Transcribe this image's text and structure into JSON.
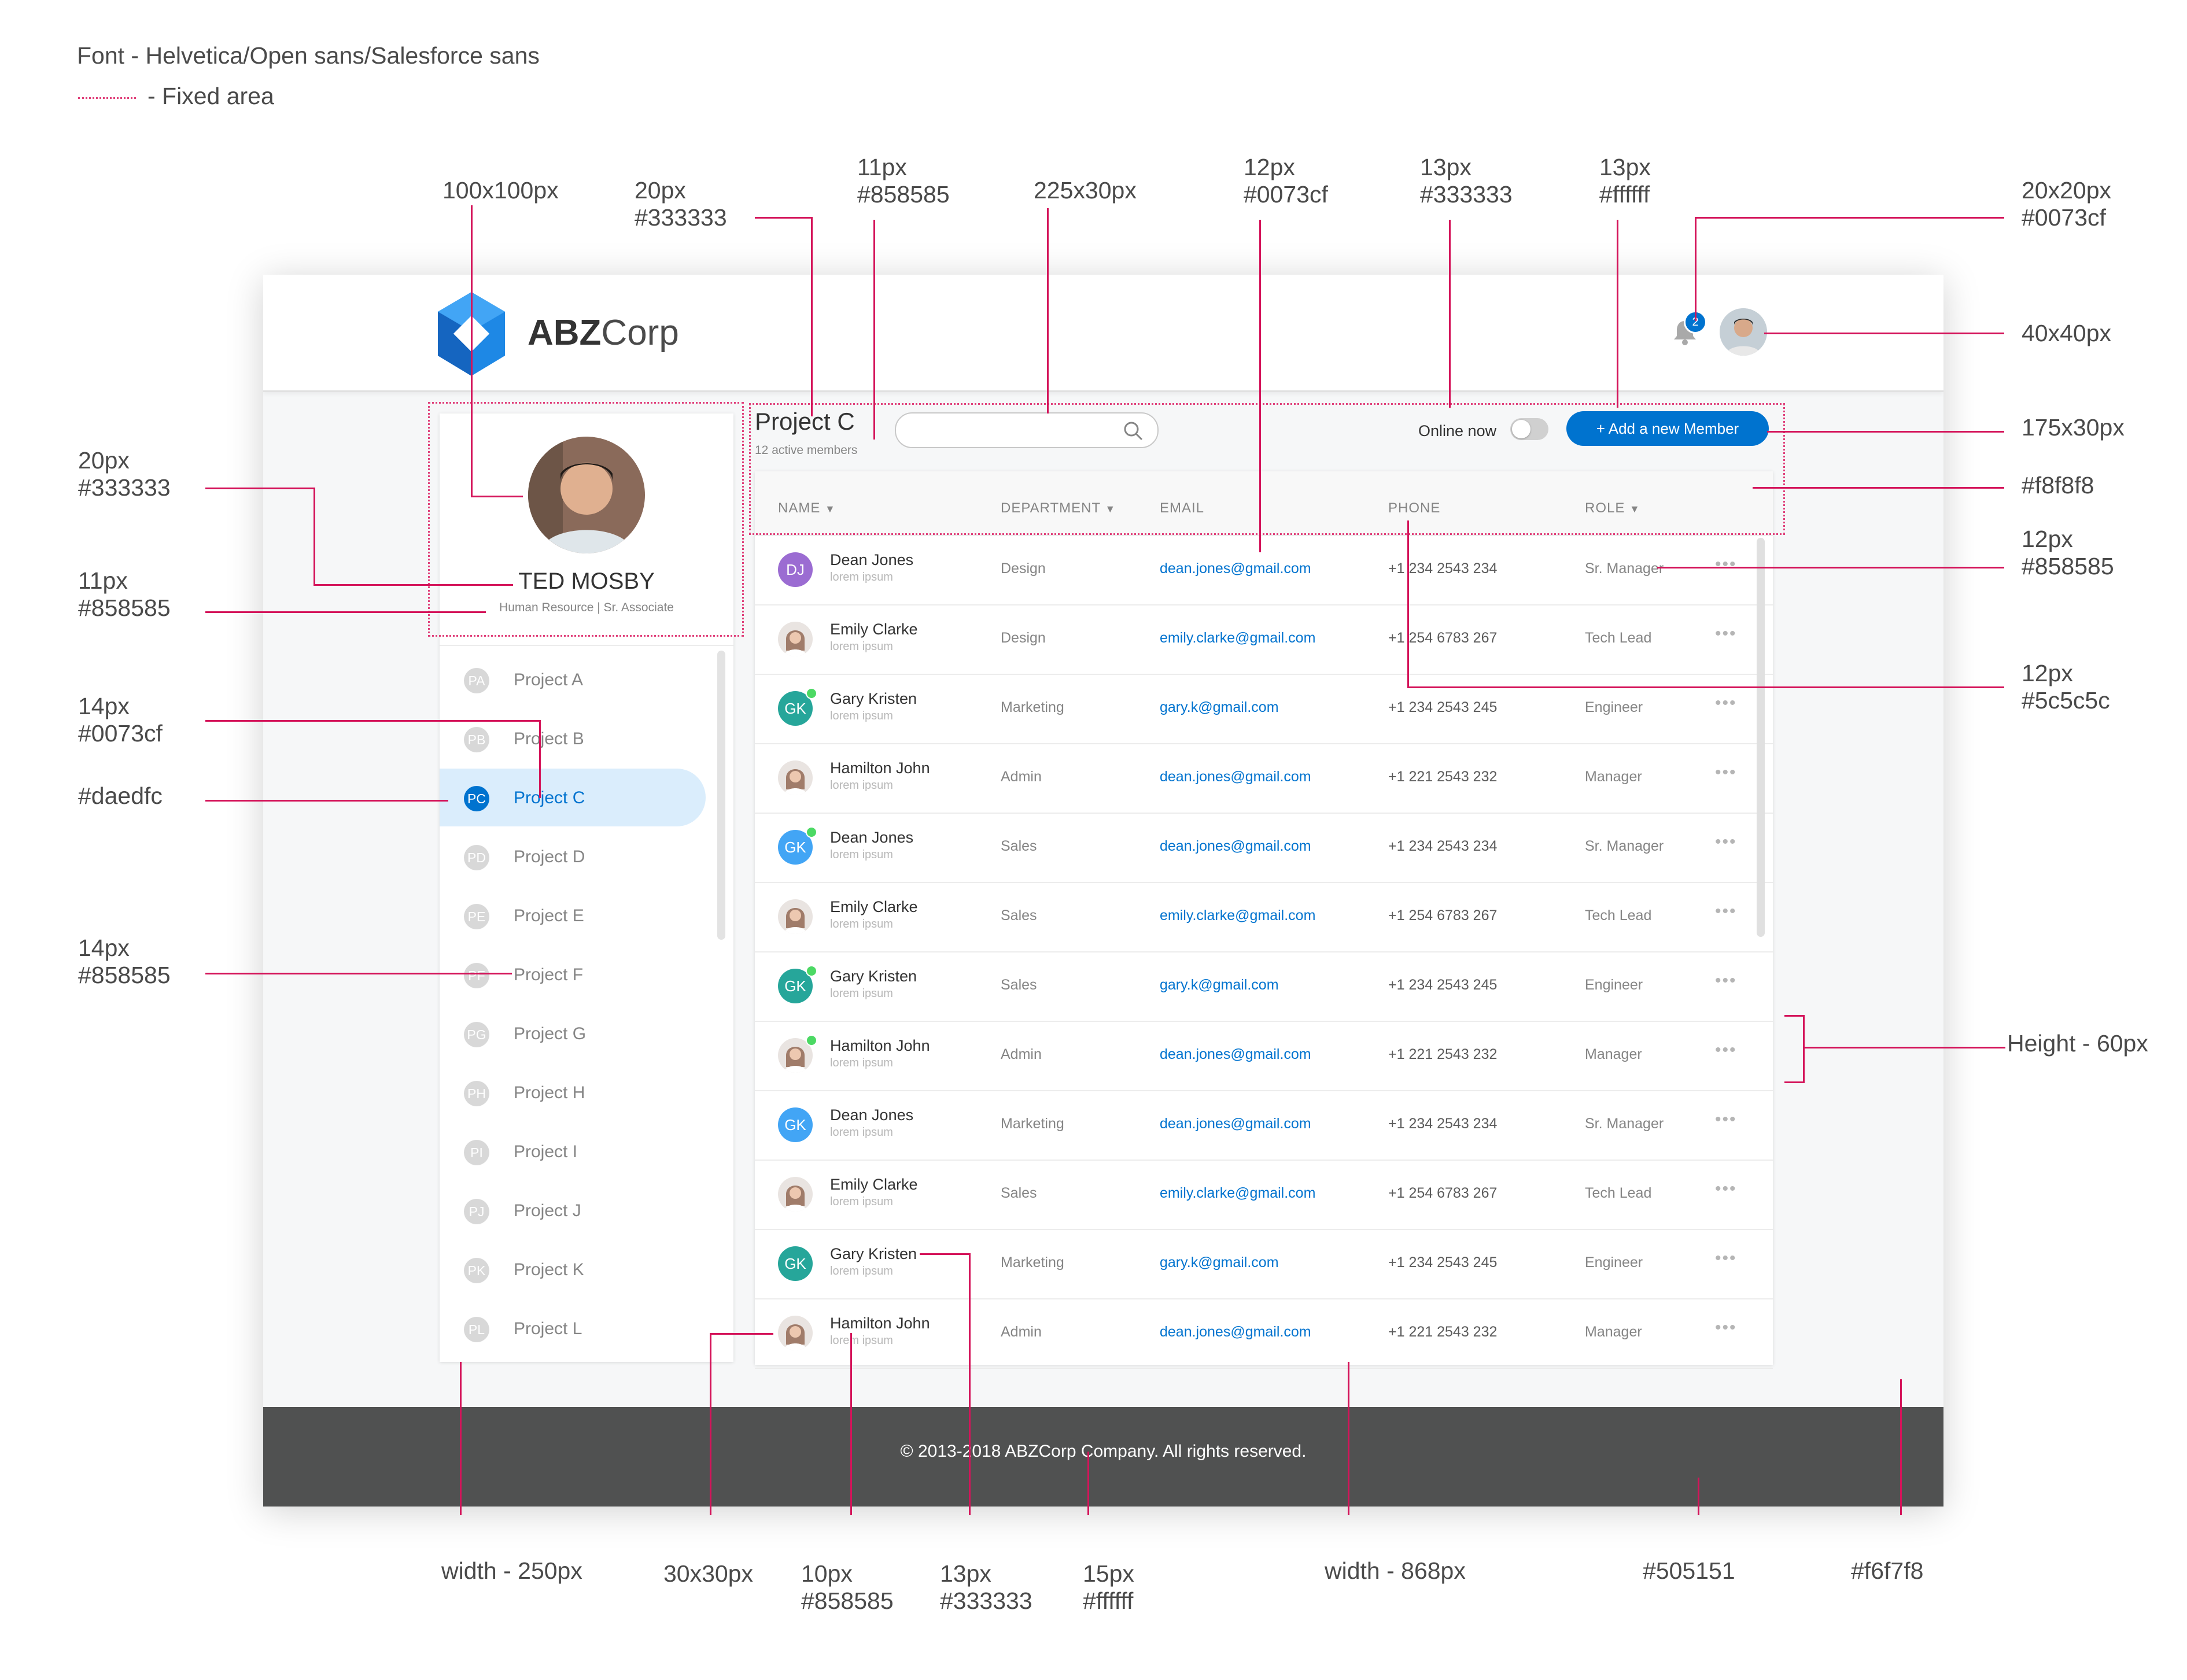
{
  "notes": {
    "font": "Font - Helvetica/Open sans/Salesforce sans",
    "fixed_area": "- Fixed area",
    "avatar_size": "100x100px",
    "title_size": "20px",
    "title_color": "#333333",
    "subtitle_size": "11px",
    "subtitle_color": "#858585",
    "search_size": "225x30px",
    "email_size": "12px",
    "email_color": "#0073cf",
    "online_size": "13px",
    "online_color": "#333333",
    "button_text_size": "13px",
    "button_text_color": "#ffffff",
    "notif_size": "20x20px",
    "notif_color": "#0073cf",
    "user_avatar_size": "40x40px",
    "button_size": "175x30px",
    "header_bg": "#f8f8f8",
    "role_size": "12px",
    "role_color": "#858585",
    "phone_size": "12px",
    "phone_color": "#5c5c5c",
    "name_size": "20px",
    "name_color": "#333333",
    "position_size": "11px",
    "position_color": "#858585",
    "active_size": "14px",
    "active_color": "#0073cf",
    "active_bg": "#daedfc",
    "project_size": "14px",
    "project_color": "#858585",
    "row_height": "Height - 60px",
    "sidebar_width": "width - 250px",
    "avatar_small": "30x30px",
    "sub_size": "10px",
    "sub_color": "#858585",
    "member_name_size": "13px",
    "member_name_color": "#333333",
    "footer_size": "15px",
    "footer_color": "#ffffff",
    "table_width": "width - 868px",
    "footer_bg": "#505151",
    "page_bg": "#f6f7f8"
  },
  "header": {
    "brand_bold": "ABZ",
    "brand_light": "Corp",
    "notification_count": "2"
  },
  "profile": {
    "name": "TED MOSBY",
    "position": "Human Resource | Sr. Associate"
  },
  "projects": [
    {
      "initials": "PA",
      "label": "Project A"
    },
    {
      "initials": "PB",
      "label": "Project B"
    },
    {
      "initials": "PC",
      "label": "Project C"
    },
    {
      "initials": "PD",
      "label": "Project D"
    },
    {
      "initials": "PE",
      "label": "Project E"
    },
    {
      "initials": "PF",
      "label": "Project F"
    },
    {
      "initials": "PG",
      "label": "Project G"
    },
    {
      "initials": "PH",
      "label": "Project H"
    },
    {
      "initials": "PI",
      "label": "Project I"
    },
    {
      "initials": "PJ",
      "label": "Project J"
    },
    {
      "initials": "PK",
      "label": "Project K"
    },
    {
      "initials": "PL",
      "label": "Project L"
    }
  ],
  "main": {
    "title": "Project C",
    "subtitle": "12 active members",
    "search_placeholder": "",
    "online_label": "Online now",
    "add_button": "+ Add a new Member"
  },
  "table": {
    "columns": [
      "NAME",
      "DEPARTMENT",
      "EMAIL",
      "PHONE",
      "ROLE"
    ],
    "rows": [
      {
        "name": "Dean Jones",
        "sub": "lorem ipsum",
        "dept": "Design",
        "email": "dean.jones@gmail.com",
        "phone": "+1 234 2543 234",
        "role": "Sr. Manager",
        "initials": "DJ",
        "avatar_color": "#9b6cd2",
        "photo": false,
        "online": false
      },
      {
        "name": "Emily Clarke",
        "sub": "lorem ipsum",
        "dept": "Design",
        "email": "emily.clarke@gmail.com",
        "phone": "+1 254 6783 267",
        "role": "Tech Lead",
        "initials": "",
        "avatar_color": "#a07c6a",
        "photo": true,
        "online": false
      },
      {
        "name": "Gary Kristen",
        "sub": "lorem ipsum",
        "dept": "Marketing",
        "email": "gary.k@gmail.com",
        "phone": "+1 234 2543 245",
        "role": "Engineer",
        "initials": "GK",
        "avatar_color": "#26a69a",
        "photo": false,
        "online": true
      },
      {
        "name": "Hamilton John",
        "sub": "lorem ipsum",
        "dept": "Admin",
        "email": "dean.jones@gmail.com",
        "phone": "+1 221 2543 232",
        "role": "Manager",
        "initials": "",
        "avatar_color": "#a07c6a",
        "photo": true,
        "online": false
      },
      {
        "name": "Dean Jones",
        "sub": "lorem ipsum",
        "dept": "Sales",
        "email": "dean.jones@gmail.com",
        "phone": "+1 234 2543 234",
        "role": "Sr. Manager",
        "initials": "GK",
        "avatar_color": "#42a5f5",
        "photo": false,
        "online": true
      },
      {
        "name": "Emily Clarke",
        "sub": "lorem ipsum",
        "dept": "Sales",
        "email": "emily.clarke@gmail.com",
        "phone": "+1 254 6783 267",
        "role": "Tech Lead",
        "initials": "",
        "avatar_color": "#a07c6a",
        "photo": true,
        "online": false
      },
      {
        "name": "Gary Kristen",
        "sub": "lorem ipsum",
        "dept": "Sales",
        "email": "gary.k@gmail.com",
        "phone": "+1 234 2543 245",
        "role": "Engineer",
        "initials": "GK",
        "avatar_color": "#26a69a",
        "photo": false,
        "online": true
      },
      {
        "name": "Hamilton John",
        "sub": "lorem ipsum",
        "dept": "Admin",
        "email": "dean.jones@gmail.com",
        "phone": "+1 221 2543 232",
        "role": "Manager",
        "initials": "",
        "avatar_color": "#a07c6a",
        "photo": true,
        "online": true
      },
      {
        "name": "Dean Jones",
        "sub": "lorem ipsum",
        "dept": "Marketing",
        "email": "dean.jones@gmail.com",
        "phone": "+1 234 2543 234",
        "role": "Sr. Manager",
        "initials": "GK",
        "avatar_color": "#42a5f5",
        "photo": false,
        "online": false
      },
      {
        "name": "Emily Clarke",
        "sub": "lorem ipsum",
        "dept": "Sales",
        "email": "emily.clarke@gmail.com",
        "phone": "+1 254 6783 267",
        "role": "Tech Lead",
        "initials": "",
        "avatar_color": "#a07c6a",
        "photo": true,
        "online": false
      },
      {
        "name": "Gary Kristen",
        "sub": "lorem ipsum",
        "dept": "Marketing",
        "email": "gary.k@gmail.com",
        "phone": "+1 234 2543 245",
        "role": "Engineer",
        "initials": "GK",
        "avatar_color": "#26a69a",
        "photo": false,
        "online": false
      },
      {
        "name": "Hamilton John",
        "sub": "lorem ipsum",
        "dept": "Admin",
        "email": "dean.jones@gmail.com",
        "phone": "+1 221 2543 232",
        "role": "Manager",
        "initials": "",
        "avatar_color": "#a07c6a",
        "photo": true,
        "online": false
      }
    ],
    "more_glyph": "•••"
  },
  "footer": {
    "text": "© 2013-2018 ABZCorp Company. All rights reserved."
  },
  "colors": {
    "accent": "#0073cf",
    "active_bg": "#daedfc",
    "footer_bg": "#505151",
    "page_bg": "#f6f7f8",
    "annotation": "#d4145a"
  }
}
